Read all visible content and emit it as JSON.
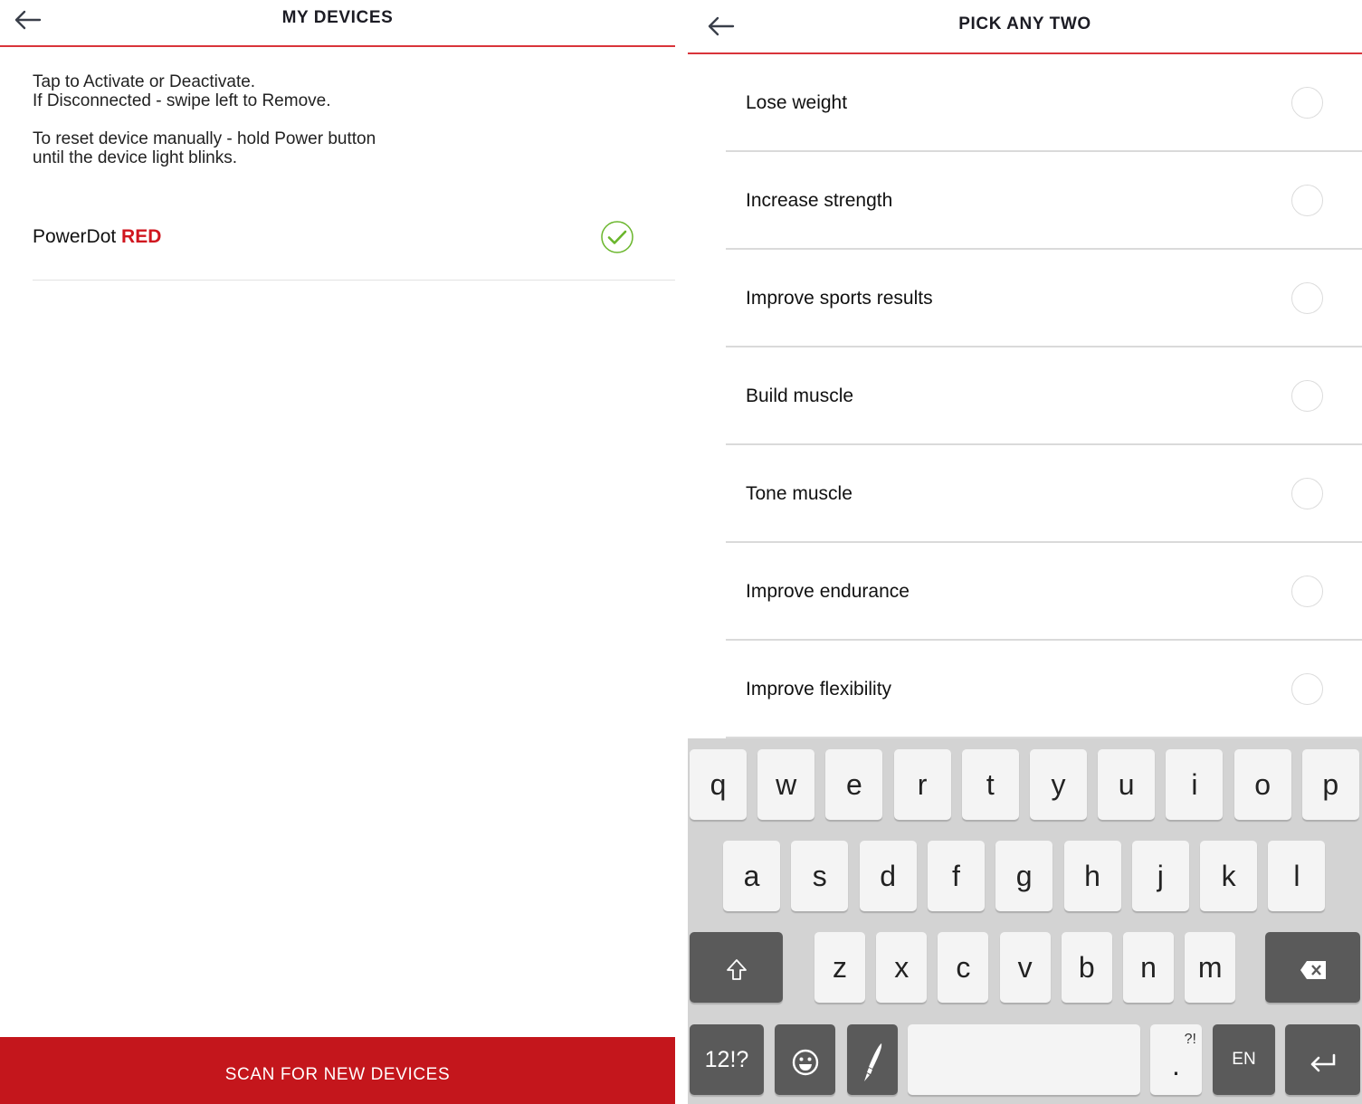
{
  "colors": {
    "brand_red": "#c4161c",
    "header_rule": "#d9343a",
    "check_green": "#6ab62c",
    "keyboard_bg": "#d3d3d3",
    "key_light": "#f4f4f4",
    "key_dark": "#5a5a5a"
  },
  "my_devices": {
    "back_icon": "arrow-left-icon",
    "title": "MY DEVICES",
    "instructions": [
      "Tap to Activate or Deactivate.",
      "If Disconnected - swipe left to Remove.",
      "To reset device manually - hold Power button",
      "until the device light blinks."
    ],
    "devices": [
      {
        "name": "PowerDot",
        "variant": "RED",
        "status_icon": "check-circle-icon",
        "active": true
      }
    ],
    "scan_button": "SCAN FOR NEW DEVICES"
  },
  "pick_any_two": {
    "back_icon": "arrow-left-icon",
    "title": "PICK ANY TWO",
    "options": [
      {
        "label": "Lose weight",
        "selected": false
      },
      {
        "label": "Increase strength",
        "selected": false
      },
      {
        "label": "Improve sports results",
        "selected": false
      },
      {
        "label": "Build muscle",
        "selected": false
      },
      {
        "label": "Tone muscle",
        "selected": false
      },
      {
        "label": "Improve endurance",
        "selected": false
      },
      {
        "label": "Improve flexibility",
        "selected": false
      }
    ]
  },
  "keyboard": {
    "row1": [
      "q",
      "w",
      "e",
      "r",
      "t",
      "y",
      "u",
      "i",
      "o",
      "p"
    ],
    "row2": [
      "a",
      "s",
      "d",
      "f",
      "g",
      "h",
      "j",
      "k",
      "l"
    ],
    "row3": [
      "z",
      "x",
      "c",
      "v",
      "b",
      "n",
      "m"
    ],
    "shift_icon": "shift-icon",
    "backspace_icon": "backspace-icon",
    "symbols_label": "12!?",
    "emoji_icon": "emoji-icon",
    "handwriting_icon": "pen-icon",
    "space_label": "",
    "period_label": ".",
    "period_hint": "?!",
    "language_label": "EN",
    "enter_icon": "enter-icon"
  }
}
